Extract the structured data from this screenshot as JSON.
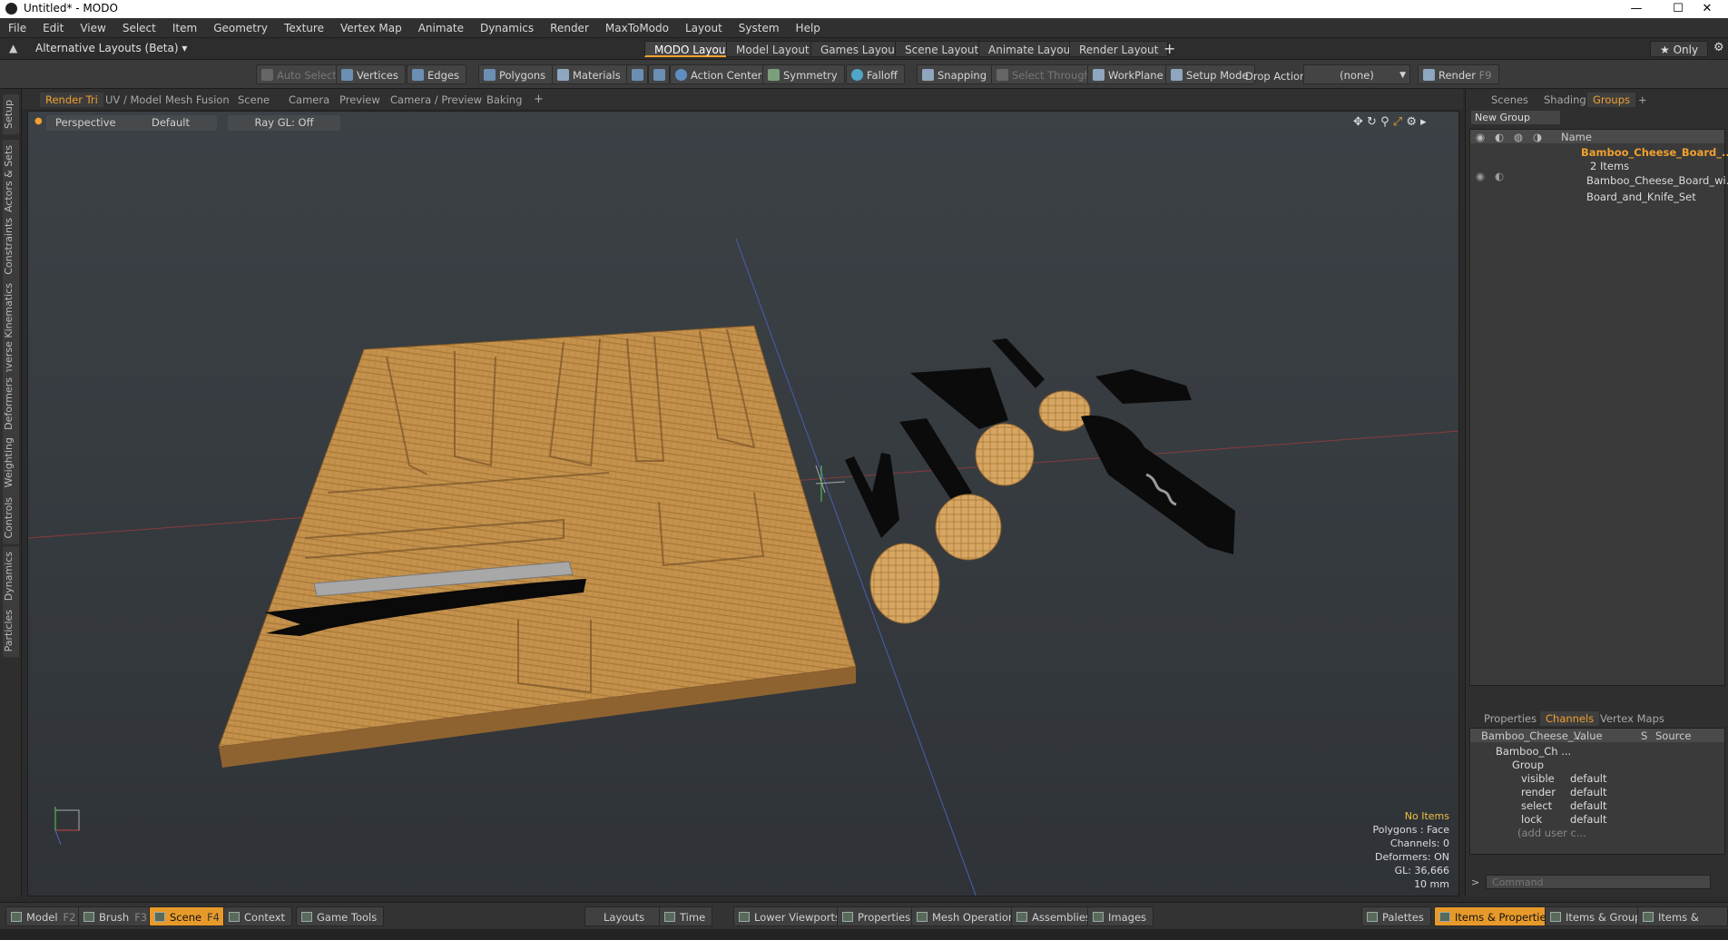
{
  "window": {
    "title": "Untitled* - MODO",
    "min": "—",
    "max": "☐",
    "close": "✕"
  },
  "menu": [
    "File",
    "Edit",
    "View",
    "Select",
    "Item",
    "Geometry",
    "Texture",
    "Vertex Map",
    "Animate",
    "Dynamics",
    "Render",
    "MaxToModo",
    "Layout",
    "System",
    "Help"
  ],
  "layoutbar": {
    "alt_layouts": "Alternative Layouts (Beta) ▾",
    "tabs": [
      "MODO Layout",
      "Model Layout",
      "Games Layout",
      "Scene Layout",
      "Animate Layout",
      "Render Layout"
    ],
    "add": "+",
    "only": "★  Only"
  },
  "toolbar": {
    "auto_select": "Auto Select",
    "vertices": "Vertices",
    "edges": "Edges",
    "polygons": "Polygons",
    "materials": "Materials",
    "action_center": "Action Center",
    "symmetry": "Symmetry",
    "falloff": "Falloff",
    "snapping": "Snapping",
    "select_through": "Select Through",
    "workplane": "WorkPlane",
    "setup_mode": "Setup Mode",
    "drop_action": "Drop Action",
    "drop_value": "(none)",
    "render": "Render",
    "render_key": "F9"
  },
  "lefttabs": [
    "Setup",
    "Actors & Sets",
    "Constraints",
    "Inverse Kinematics",
    "Deformers",
    "Weighting",
    "Controls",
    "Dynamics",
    "Particles"
  ],
  "vptabs": [
    "Render Tri",
    "UV / Model",
    "Mesh Fusion",
    "Scene",
    "Camera",
    "Preview",
    "Camera / Preview",
    "Baking"
  ],
  "viewport": {
    "perspective": "Perspective",
    "shading": "Default",
    "raygl": "Ray GL: Off",
    "stats": [
      "No Items",
      "Polygons : Face",
      "Channels: 0",
      "Deformers: ON",
      "GL: 36,666",
      "10 mm"
    ]
  },
  "rpanel": {
    "tabs": [
      "Scenes",
      "Shading",
      "Groups"
    ],
    "new_group": "New Group",
    "name_header": "Name",
    "group_name": "Bamboo_Cheese_Board_...",
    "group_count": "2 Items",
    "child1": "Bamboo_Cheese_Board_wi...",
    "child2": "Board_and_Knife_Set",
    "ptabs": [
      "Properties",
      "Channels",
      "Vertex Maps"
    ],
    "ch_header": {
      "name": "Bamboo_Cheese_...",
      "value": "Value",
      "s": "S",
      "source": "Source"
    },
    "ch_item": "Bamboo_Ch ...",
    "ch_group": "Group",
    "channels": [
      {
        "name": "visible",
        "value": "default"
      },
      {
        "name": "render",
        "value": "default"
      },
      {
        "name": "select",
        "value": "default"
      },
      {
        "name": "lock",
        "value": "default"
      }
    ],
    "add_user": "(add user c...",
    "command_placeholder": "Command"
  },
  "bottombar": {
    "model": "Model",
    "model_key": "F2",
    "brush": "Brush",
    "brush_key": "F3",
    "scene": "Scene",
    "scene_key": "F4",
    "context": "Context",
    "game_tools": "Game Tools",
    "layouts": "Layouts",
    "time": "Time",
    "lower_viewports": "Lower Viewports",
    "properties": "Properties",
    "mesh_operations": "Mesh Operations",
    "assemblies": "Assemblies",
    "images": "Images",
    "palettes": "Palettes",
    "items_properties": "Items & Properties",
    "items_groups": "Items & Groups",
    "items_shading": "Items & Shading"
  },
  "colors": {
    "accent": "#f0a030",
    "wood": "#c0904a",
    "knife": "#0a0a0a"
  }
}
